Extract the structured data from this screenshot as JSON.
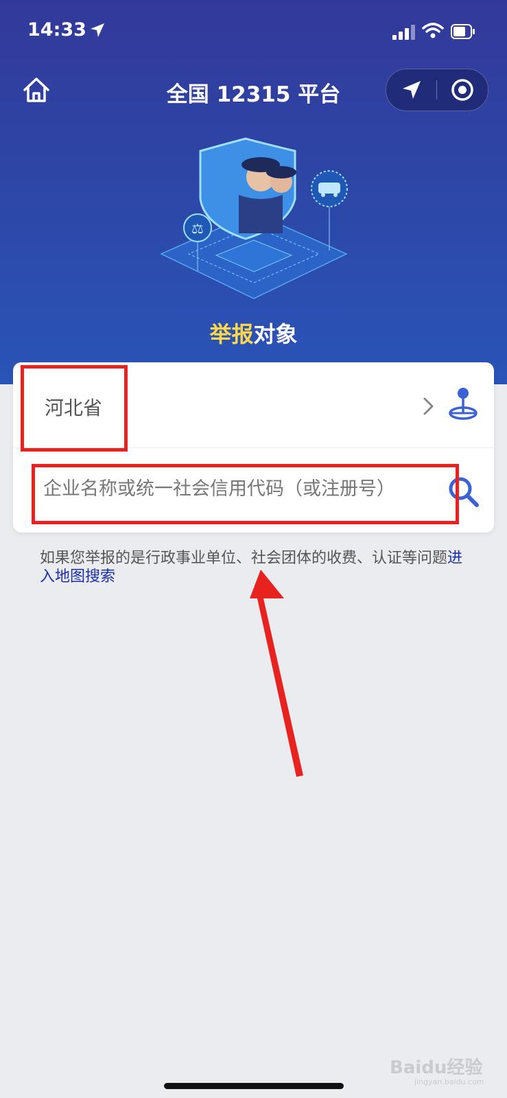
{
  "status_bar": {
    "time": "14:33"
  },
  "nav": {
    "title": "全国 12315 平台"
  },
  "section": {
    "title_highlight": "举报",
    "title_rest": "对象"
  },
  "region": {
    "value": "河北省"
  },
  "search": {
    "placeholder": "企业名称或统一社会信用代码（或注册号）"
  },
  "hint": {
    "text": "如果您举报的是行政事业单位、社会团体的收费、认证等问题",
    "link": "进入地图搜索"
  },
  "watermark": {
    "text": "Baidu经验",
    "sub": "jingyan.baidu.com"
  },
  "colors": {
    "header": "#33399a",
    "highlight": "#ffd84a",
    "link": "#1a2fa8",
    "annotation": "#e8231f",
    "icon_blue": "#3a62d6"
  }
}
